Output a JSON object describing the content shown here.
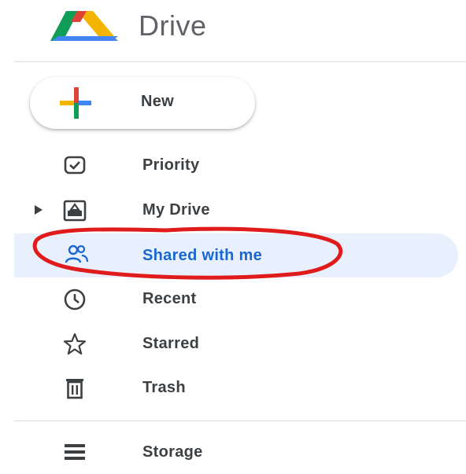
{
  "app": {
    "title": "Drive",
    "logo_icon": "google-drive-logo-icon"
  },
  "new_button": {
    "label": "New",
    "icon": "plus-multicolor-icon"
  },
  "nav": {
    "items": [
      {
        "label": "Priority",
        "icon": "priority-check-icon",
        "active": false
      },
      {
        "label": "My Drive",
        "icon": "my-drive-icon",
        "active": false,
        "expandable": true
      },
      {
        "label": "Shared with me",
        "icon": "shared-people-icon",
        "active": true
      },
      {
        "label": "Recent",
        "icon": "clock-icon",
        "active": false
      },
      {
        "label": "Starred",
        "icon": "star-outline-icon",
        "active": false
      },
      {
        "label": "Trash",
        "icon": "trash-icon",
        "active": false
      },
      {
        "label": "Storage",
        "icon": "storage-icon",
        "active": false
      }
    ]
  },
  "colors": {
    "active_bg": "#e8f0fe",
    "active_text": "#1967d2",
    "text": "#3c4043",
    "annotation": "#e01b1b",
    "drive_blue": "#4285f4",
    "drive_green": "#0f9d58",
    "drive_yellow": "#f4b400",
    "drive_red": "#db4437"
  }
}
